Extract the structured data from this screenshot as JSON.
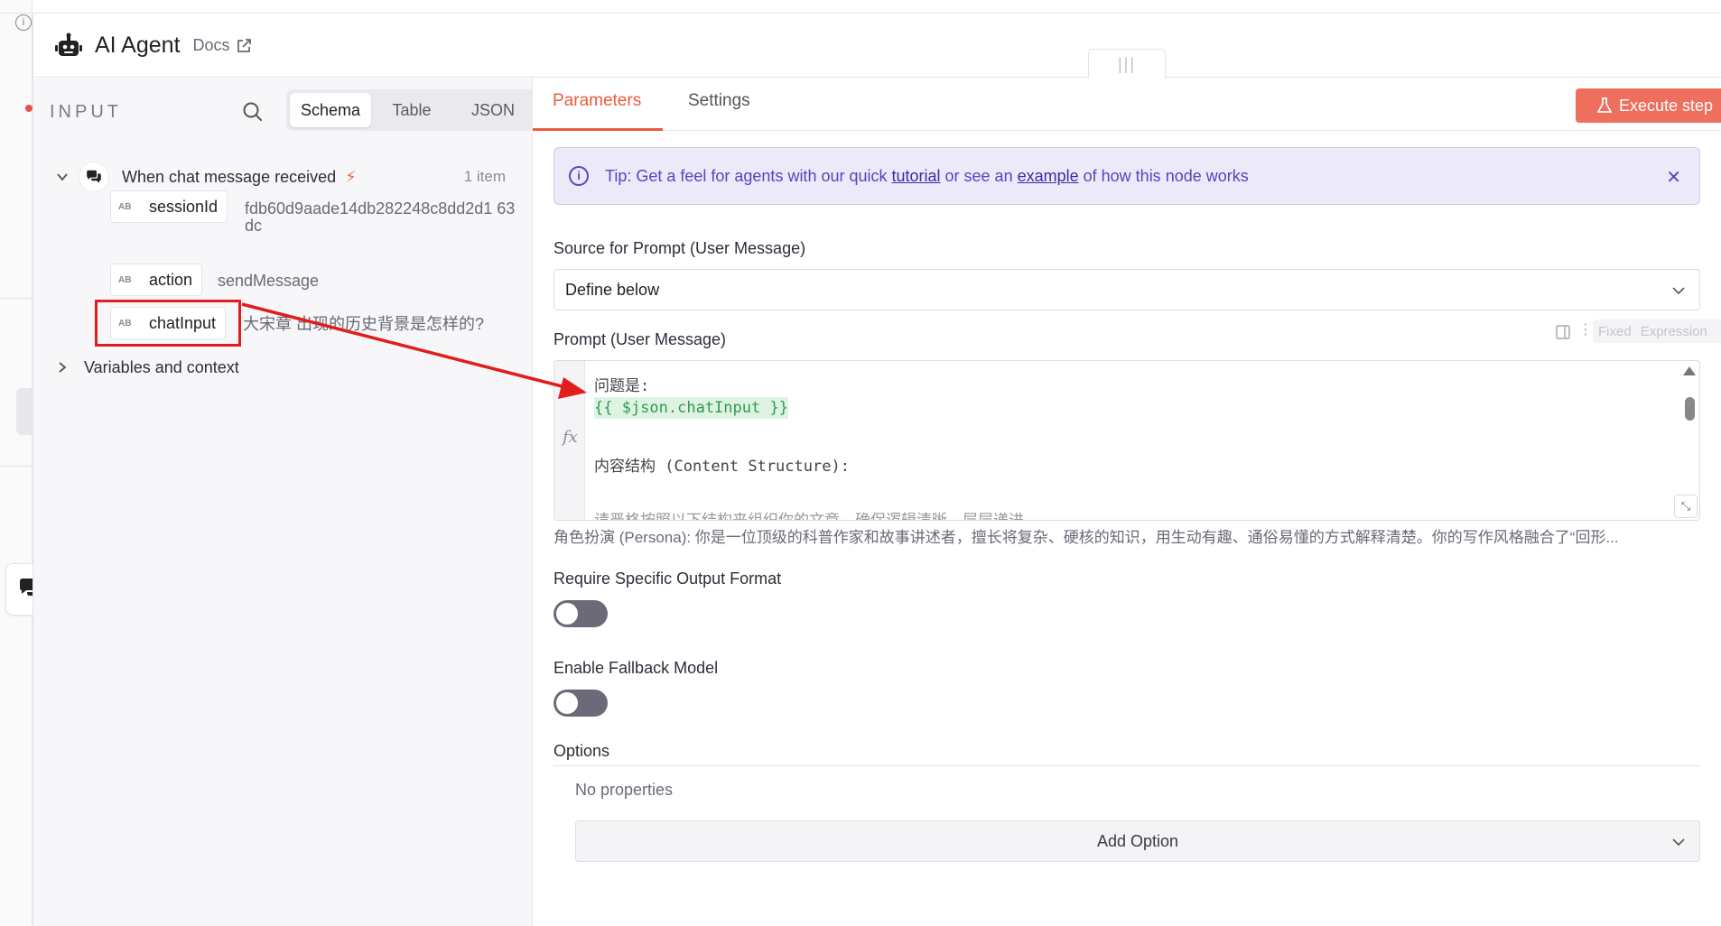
{
  "header": {
    "title": "AI Agent",
    "docs_label": "Docs"
  },
  "input": {
    "title": "INPUT",
    "view_tabs": [
      "Schema",
      "Table",
      "JSON"
    ],
    "active_view": "Schema",
    "trigger": {
      "name": "When chat message received",
      "count": "1 item"
    },
    "fields": [
      {
        "type": "AB",
        "key": "sessionId",
        "value": "fdb60d9aade14db282248c8dd2d1 63dc"
      },
      {
        "type": "AB",
        "key": "action",
        "value": "sendMessage"
      },
      {
        "type": "AB",
        "key": "chatInput",
        "value": "大宋章 出现的历史背景是怎样的?"
      }
    ],
    "variables_label": "Variables and context"
  },
  "params": {
    "tabs": [
      "Parameters",
      "Settings"
    ],
    "active_tab": "Parameters",
    "execute_label": "Execute step",
    "tip": {
      "prefix": "Tip: Get a feel for agents with our quick ",
      "link1": "tutorial",
      "middle": " or see an ",
      "link2": "example",
      "suffix": " of how this node works"
    },
    "source_label": "Source for Prompt (User Message)",
    "source_value": "Define below",
    "prompt_label": "Prompt (User Message)",
    "mode_fixed": "Fixed",
    "mode_expression": "Expression",
    "editor_lines": {
      "l1": "问题是:",
      "l2": "{{ $json.chatInput }}",
      "l3": "内容结构 (Content Structure):",
      "l4": "请严格按照以下结构来组织你的文章，确保逻辑清晰、层层递进"
    },
    "prompt_preview": "角色扮演 (Persona): 你是一位顶级的科普作家和故事讲述者，擅长将复杂、硬核的知识，用生动有趣、通俗易懂的方式解释清楚。你的写作风格融合了“回形...",
    "output_format_label": "Require Specific Output Format",
    "fallback_label": "Enable Fallback Model",
    "options_label": "Options",
    "no_properties": "No properties",
    "add_option_label": "Add Option"
  },
  "colors": {
    "accent": "#ea5b3c",
    "execute_bg": "#ee6f5c",
    "tip_bg": "#eceaf8",
    "tip_text": "#5645c0",
    "annotation": "#e11d1d",
    "expression_green": "#2f9a53"
  },
  "icons": {
    "header": "robot-icon",
    "docs": "external-link-icon",
    "search": "search-icon",
    "trigger": "chat-bubbles-icon",
    "bolt": "lightning-icon",
    "execute": "flask-icon",
    "tip": "info-icon",
    "close": "close-icon",
    "toggle_off": "toggle-off"
  },
  "toggles": {
    "output_format_enabled": false,
    "fallback_enabled": false
  }
}
